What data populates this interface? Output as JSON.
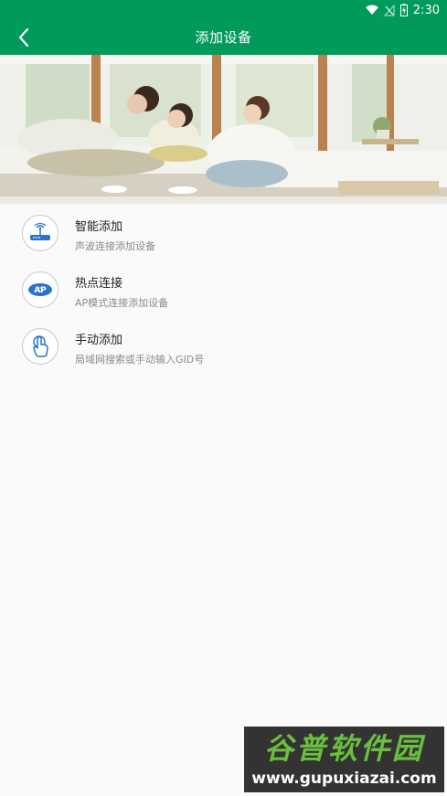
{
  "status_bar": {
    "time": "2:30",
    "icons": [
      "wifi-icon",
      "signal-off-icon",
      "battery-charging-icon"
    ]
  },
  "app_bar": {
    "title": "添加设备",
    "back_icon": "chevron-left-icon"
  },
  "options": [
    {
      "label": "智能添加",
      "sub": "声波连接添加设备",
      "icon": "router-icon"
    },
    {
      "label": "热点连接",
      "sub": "AP模式连接添加设备",
      "icon": "ap-icon",
      "icon_text": "AP"
    },
    {
      "label": "手动添加",
      "sub": "局域网搜索或手动输入GID号",
      "icon": "touch-hand-icon"
    }
  ],
  "watermark": {
    "title": "谷普软件园",
    "url": "www.gupuxiazai.com"
  },
  "colors": {
    "primary": "#009a5b",
    "icon_blue": "#2a73c9",
    "label_text": "#222222",
    "sub_text": "#8a8a8a"
  }
}
